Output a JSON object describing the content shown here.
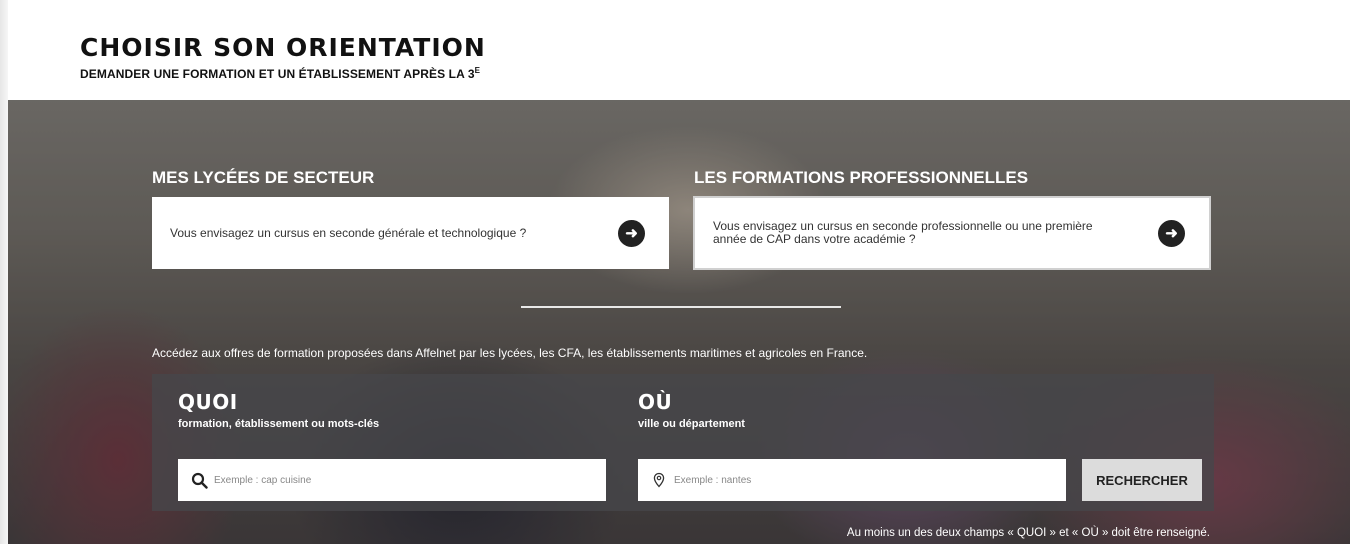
{
  "header": {
    "title": "CHOISIR SON ORIENTATION",
    "subtitle": "DEMANDER UNE FORMATION ET UN ÉTABLISSEMENT APRÈS LA 3",
    "subtitle_sup": "E"
  },
  "sections": [
    {
      "title": "MES LYCÉES DE SECTEUR",
      "card_text": "Vous envisagez un cursus en seconde générale et technologique ?",
      "icon": "arrow-right-circle-icon"
    },
    {
      "title": "LES FORMATIONS PROFESSIONNELLES",
      "card_text": "Vous envisagez un cursus en seconde professionnelle ou une première année de CAP dans votre académie ?",
      "icon": "arrow-right-circle-icon"
    }
  ],
  "intro": "Accédez aux offres de formation proposées dans Affelnet par les lycées, les CFA, les établissements maritimes et agricoles en France.",
  "search": {
    "quoi": {
      "title": "QUOI",
      "subtitle": "formation, établissement ou mots-clés",
      "placeholder": "Exemple : cap cuisine",
      "icon": "search-icon"
    },
    "ou": {
      "title": "OÙ",
      "subtitle": "ville ou département",
      "placeholder": "Exemple : nantes",
      "icon": "location-pin-icon"
    },
    "button_label": "RECHERCHER",
    "note": "Au moins un des deux champs « QUOI » et « OÙ » doit être renseigné."
  },
  "colors": {
    "panel": "#46464a",
    "button": "#dcdcdc",
    "text_dark": "#111111",
    "text_light": "#ffffff"
  }
}
